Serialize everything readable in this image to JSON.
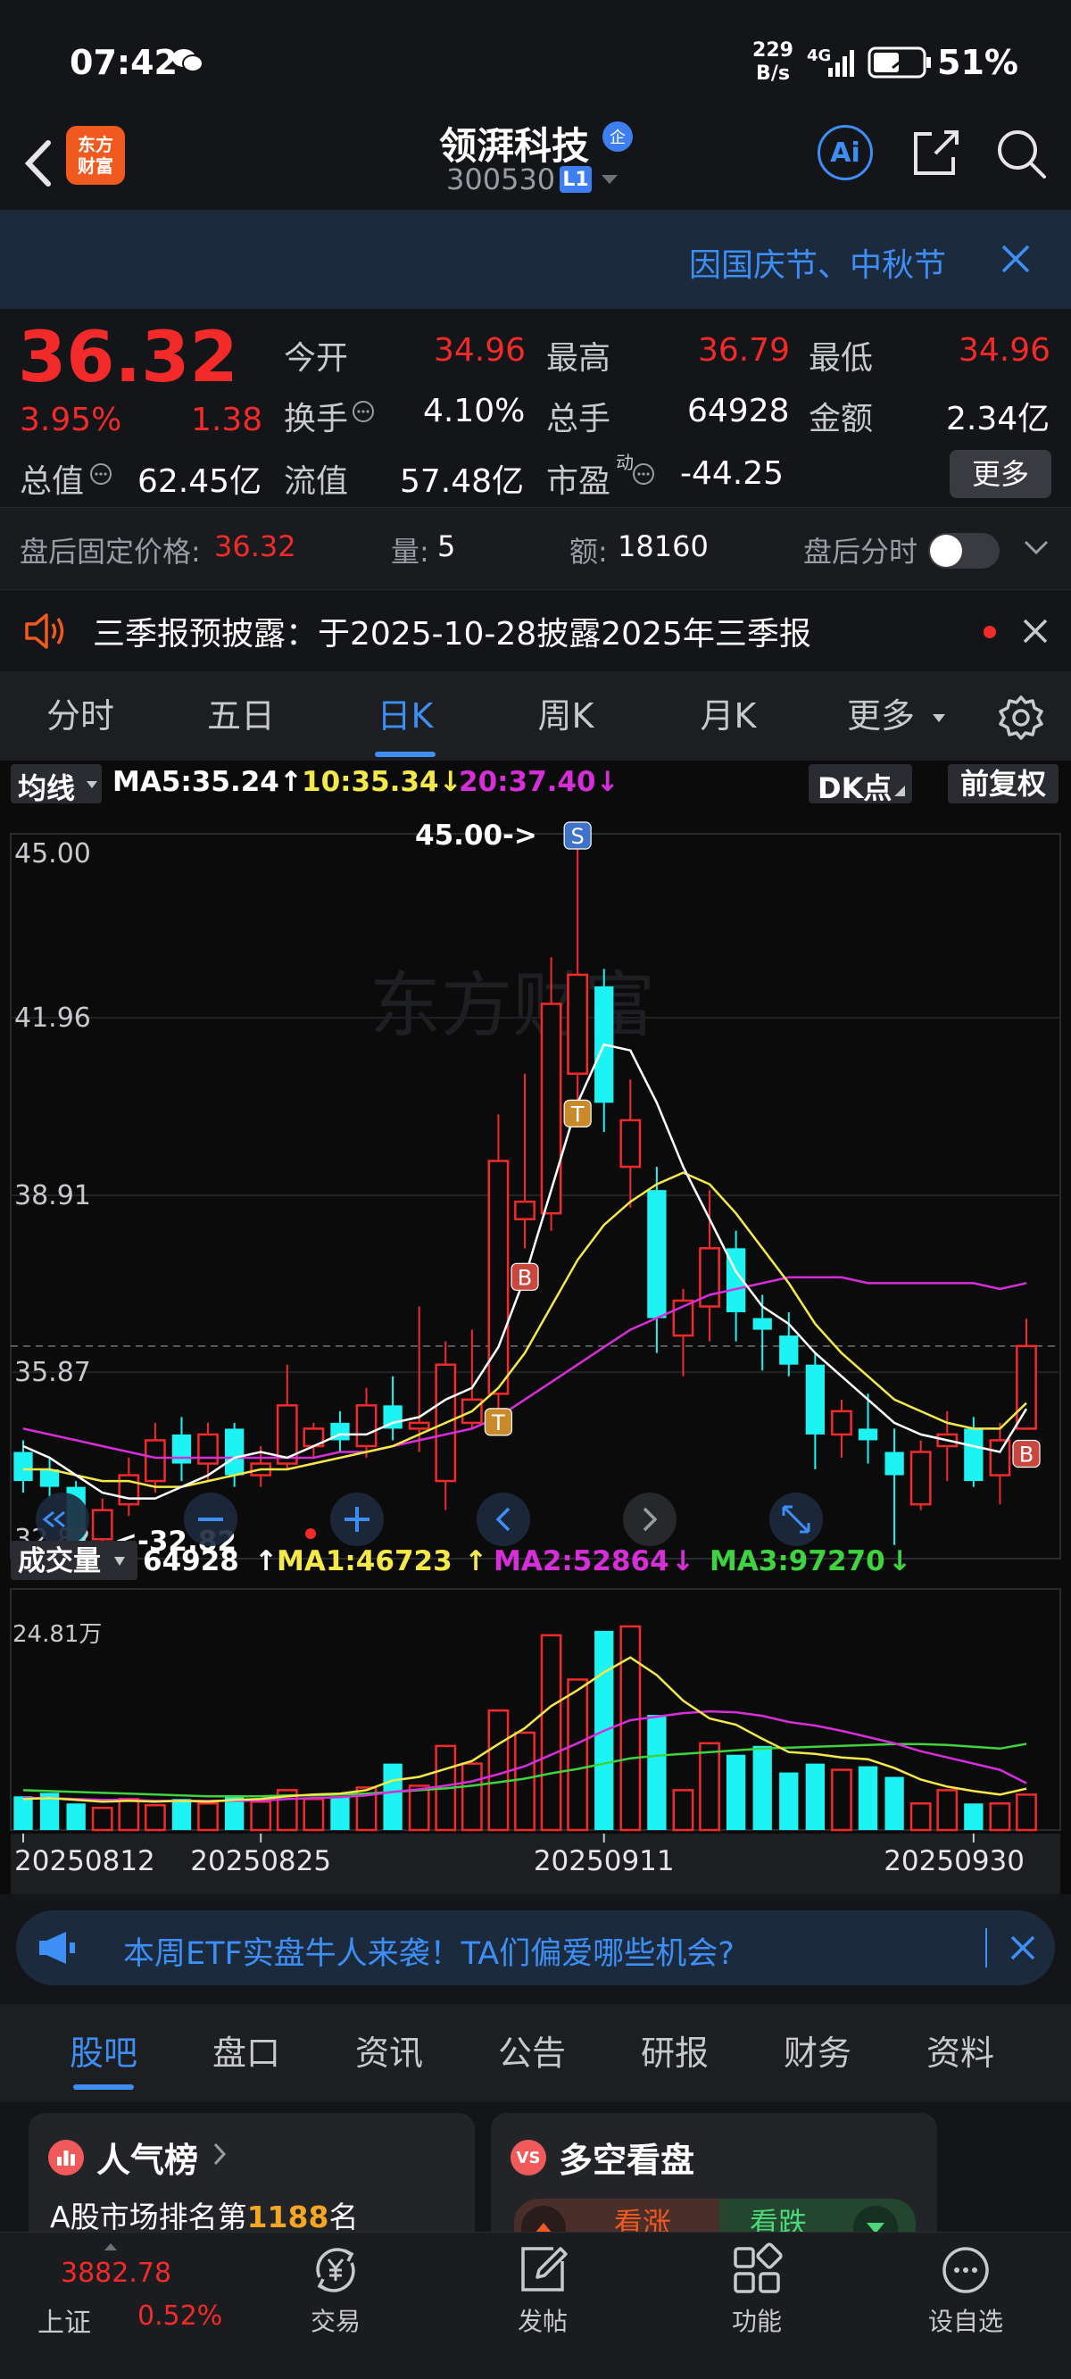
{
  "status": {
    "time": "07:42",
    "speed_top": "229",
    "speed_bottom": "B/s",
    "network": "4G",
    "battery": "51%"
  },
  "header": {
    "stock_name": "领湃科技",
    "code": "300530",
    "level": "L1",
    "logo_top": "东方",
    "logo_bottom": "财富",
    "ai_label": "Ai",
    "qi_badge": "企"
  },
  "banner": {
    "text": "因国庆节、中秋节"
  },
  "quote": {
    "price": "36.32",
    "pct": "3.95%",
    "change": "1.38",
    "rows": [
      [
        {
          "label": "今开",
          "value": "34.96",
          "color": "red"
        },
        {
          "label": "最高",
          "value": "36.79",
          "color": "red"
        },
        {
          "label": "最低",
          "value": "34.96",
          "color": "red"
        }
      ],
      [
        {
          "label": "换手",
          "value": "4.10%",
          "color": "white"
        },
        {
          "label": "总手",
          "value": "64928",
          "color": "white"
        },
        {
          "label": "金额",
          "value": "2.34亿",
          "color": "white"
        }
      ]
    ],
    "row3": [
      {
        "label": "总值",
        "value": "62.45亿"
      },
      {
        "label": "流值",
        "value": "57.48亿"
      },
      {
        "label": "市盈",
        "value": "-44.25",
        "sup": "动"
      }
    ],
    "more": "更多"
  },
  "after_hours": {
    "label": "盘后固定价格:",
    "price": "36.32",
    "vol_label": "量:",
    "vol": "5",
    "amt_label": "额:",
    "amt": "18160",
    "toggle_label": "盘后分时"
  },
  "notice": {
    "text": "三季报预披露：于2025-10-28披露2025年三季报"
  },
  "tabs": [
    "分时",
    "五日",
    "日K",
    "周K",
    "月K",
    "更多"
  ],
  "active_tab": 2,
  "kline": {
    "ma_selector": "均线",
    "ma5": "MA5:35.24",
    "ma10": "10:35.34",
    "ma20": "20:37.40",
    "dk_label": "DK点",
    "fq_label": "前复权",
    "high_marker": "45.00->",
    "low_marker": "<-32.82",
    "vol_selector": "成交量",
    "vol_value": "64928",
    "vma1": "MA1:46723",
    "vma2": "MA2:52864",
    "vma3": "MA3:97270",
    "vol_axis": "24.81万",
    "dates": [
      "20250812",
      "20250825",
      "20250911",
      "20250930"
    ],
    "watermark": "东方财富"
  },
  "chart_data": {
    "type": "candlestick",
    "ylim": [
      32.82,
      45.0
    ],
    "y_ticks": [
      "45.00",
      "41.96",
      "38.91",
      "35.87",
      "32.82"
    ],
    "candles": [
      {
        "o": 34.5,
        "c": 34.0,
        "h": 34.7,
        "l": 33.8
      },
      {
        "o": 34.2,
        "c": 33.9,
        "h": 34.4,
        "l": 33.7
      },
      {
        "o": 33.9,
        "c": 32.9,
        "h": 34.0,
        "l": 32.82
      },
      {
        "o": 33.0,
        "c": 33.5,
        "h": 33.7,
        "l": 32.9
      },
      {
        "o": 33.6,
        "c": 34.1,
        "h": 34.4,
        "l": 33.4
      },
      {
        "o": 34.0,
        "c": 34.7,
        "h": 35.0,
        "l": 33.8
      },
      {
        "o": 34.8,
        "c": 34.3,
        "h": 35.1,
        "l": 34.0
      },
      {
        "o": 34.3,
        "c": 34.8,
        "h": 35.0,
        "l": 34.0
      },
      {
        "o": 34.9,
        "c": 34.1,
        "h": 35.0,
        "l": 33.9
      },
      {
        "o": 34.1,
        "c": 34.3,
        "h": 34.6,
        "l": 33.9
      },
      {
        "o": 34.3,
        "c": 35.3,
        "h": 36.0,
        "l": 34.2
      },
      {
        "o": 34.6,
        "c": 34.9,
        "h": 35.0,
        "l": 34.4
      },
      {
        "o": 35.0,
        "c": 34.7,
        "h": 35.2,
        "l": 34.5
      },
      {
        "o": 34.6,
        "c": 35.3,
        "h": 35.6,
        "l": 34.4
      },
      {
        "o": 35.3,
        "c": 34.9,
        "h": 35.8,
        "l": 34.7
      },
      {
        "o": 34.9,
        "c": 35.0,
        "h": 37.0,
        "l": 34.5
      },
      {
        "o": 34.0,
        "c": 36.0,
        "h": 36.4,
        "l": 33.5
      },
      {
        "o": 35.0,
        "c": 35.4,
        "h": 36.6,
        "l": 34.9
      },
      {
        "o": 35.5,
        "c": 39.5,
        "h": 40.3,
        "l": 35.2
      },
      {
        "o": 38.5,
        "c": 38.8,
        "h": 41.0,
        "l": 38.0
      },
      {
        "o": 38.6,
        "c": 42.2,
        "h": 43.0,
        "l": 38.3
      },
      {
        "o": 41.0,
        "c": 42.7,
        "h": 45.0,
        "l": 40.5
      },
      {
        "o": 42.5,
        "c": 40.5,
        "h": 42.8,
        "l": 40.0
      },
      {
        "o": 39.4,
        "c": 40.2,
        "h": 40.9,
        "l": 38.7
      },
      {
        "o": 39.0,
        "c": 36.8,
        "h": 39.4,
        "l": 36.2
      },
      {
        "o": 36.5,
        "c": 37.1,
        "h": 37.3,
        "l": 35.8
      },
      {
        "o": 37.0,
        "c": 38.0,
        "h": 39.0,
        "l": 36.4
      },
      {
        "o": 38.0,
        "c": 36.9,
        "h": 38.3,
        "l": 36.4
      },
      {
        "o": 36.8,
        "c": 36.6,
        "h": 37.2,
        "l": 35.9
      },
      {
        "o": 36.5,
        "c": 36.0,
        "h": 36.9,
        "l": 35.8
      },
      {
        "o": 36.0,
        "c": 34.8,
        "h": 36.2,
        "l": 34.2
      },
      {
        "o": 34.8,
        "c": 35.2,
        "h": 35.4,
        "l": 34.4
      },
      {
        "o": 34.9,
        "c": 34.7,
        "h": 35.5,
        "l": 34.3
      },
      {
        "o": 34.5,
        "c": 34.1,
        "h": 34.9,
        "l": 32.9
      },
      {
        "o": 33.6,
        "c": 34.5,
        "h": 34.7,
        "l": 33.5
      },
      {
        "o": 34.6,
        "c": 34.8,
        "h": 35.2,
        "l": 34.0
      },
      {
        "o": 34.9,
        "c": 34.0,
        "h": 35.1,
        "l": 33.9
      },
      {
        "o": 34.1,
        "c": 34.7,
        "h": 35.0,
        "l": 33.6
      },
      {
        "o": 34.9,
        "c": 36.32,
        "h": 36.79,
        "l": 34.96
      }
    ],
    "ma5": [
      34.6,
      34.4,
      34.1,
      33.8,
      33.7,
      33.7,
      33.9,
      34.1,
      34.4,
      34.5,
      34.4,
      34.6,
      34.8,
      34.8,
      35.0,
      35.1,
      35.4,
      35.6,
      36.3,
      37.5,
      39.0,
      40.5,
      41.5,
      41.4,
      40.5,
      39.4,
      38.5,
      37.6,
      37.0,
      36.7,
      36.2,
      35.8,
      35.4,
      35.0,
      34.8,
      34.7,
      34.6,
      34.5,
      35.24
    ],
    "ma10": [
      34.2,
      34.2,
      34.1,
      34.0,
      34.0,
      33.9,
      33.9,
      34.0,
      34.1,
      34.2,
      34.2,
      34.3,
      34.4,
      34.5,
      34.6,
      34.8,
      35.0,
      35.2,
      35.6,
      36.2,
      37.0,
      37.8,
      38.4,
      38.8,
      39.1,
      39.3,
      39.1,
      38.6,
      38.0,
      37.4,
      36.7,
      36.2,
      35.8,
      35.4,
      35.2,
      35.0,
      34.9,
      34.9,
      35.34
    ],
    "ma20": [
      34.9,
      34.8,
      34.7,
      34.6,
      34.5,
      34.4,
      34.4,
      34.4,
      34.4,
      34.4,
      34.4,
      34.4,
      34.5,
      34.5,
      34.6,
      34.7,
      34.8,
      34.9,
      35.1,
      35.4,
      35.7,
      36.0,
      36.3,
      36.6,
      36.8,
      37.0,
      37.2,
      37.3,
      37.4,
      37.5,
      37.5,
      37.5,
      37.4,
      37.4,
      37.4,
      37.4,
      37.4,
      37.3,
      37.4
    ],
    "volume": [
      3.8,
      4.2,
      3.0,
      2.5,
      3.5,
      2.8,
      3.5,
      3.0,
      3.8,
      3.2,
      4.5,
      3.5,
      3.8,
      4.8,
      7.5,
      5.0,
      9.5,
      7.5,
      13.5,
      11.0,
      22.0,
      17.0,
      22.5,
      23.0,
      13.0,
      4.5,
      9.8,
      8.5,
      9.5,
      6.5,
      7.5,
      6.8,
      7.2,
      6.0,
      3.0,
      4.5,
      3.0,
      3.0,
      4.0
    ],
    "vol_ylim": [
      0,
      24.81
    ],
    "vma1": [
      3.5,
      3.6,
      3.4,
      3.2,
      3.3,
      3.2,
      3.3,
      3.2,
      3.4,
      3.5,
      3.8,
      4.0,
      4.1,
      4.5,
      5.6,
      6.0,
      6.9,
      7.8,
      9.7,
      11.5,
      14.0,
      15.8,
      17.8,
      19.5,
      17.5,
      14.6,
      12.6,
      11.9,
      10.3,
      8.8,
      8.6,
      8.2,
      8.0,
      7.0,
      5.7,
      4.9,
      4.4,
      4.0,
      4.67
    ],
    "vma2": [
      3.6,
      3.6,
      3.5,
      3.4,
      3.4,
      3.3,
      3.3,
      3.3,
      3.3,
      3.3,
      3.5,
      3.6,
      3.7,
      3.9,
      4.3,
      4.6,
      5.0,
      5.5,
      6.3,
      7.2,
      8.5,
      9.8,
      11.2,
      12.4,
      12.8,
      13.2,
      13.4,
      13.3,
      12.9,
      12.2,
      11.8,
      11.2,
      10.5,
      9.8,
      8.9,
      8.2,
      7.5,
      6.8,
      5.29
    ],
    "vma3": [
      4.5,
      4.4,
      4.3,
      4.2,
      4.1,
      4.0,
      3.9,
      3.8,
      3.8,
      3.8,
      3.9,
      3.9,
      4.0,
      4.1,
      4.3,
      4.5,
      4.7,
      5.0,
      5.4,
      5.8,
      6.4,
      6.9,
      7.5,
      8.1,
      8.4,
      8.6,
      8.8,
      9.0,
      9.2,
      9.3,
      9.4,
      9.5,
      9.6,
      9.7,
      9.7,
      9.6,
      9.4,
      9.2,
      9.73
    ],
    "signals": [
      {
        "i": 21,
        "label": "S",
        "pos": "above"
      },
      {
        "i": 18,
        "label": "T",
        "pos": "below"
      },
      {
        "i": 21,
        "label": "T",
        "pos": "below"
      },
      {
        "i": 19,
        "label": "B",
        "pos": "below"
      },
      {
        "i": 38,
        "label": "B",
        "pos": "below"
      }
    ],
    "x_labels": [
      "20250812",
      "20250825",
      "20250911",
      "20250930"
    ]
  },
  "ad": {
    "text": "本周ETF实盘牛人来袭！TA们偏爱哪些机会?"
  },
  "subtabs": [
    "股吧",
    "盘口",
    "资讯",
    "公告",
    "研报",
    "财务",
    "资料"
  ],
  "cards": {
    "popularity_title": "人气榜",
    "popularity_text_prefix": "A股市场排名第",
    "popularity_rank": "1188",
    "popularity_text_suffix": "名",
    "vs_title": "多空看盘",
    "bull": "看涨",
    "bear": "看跌"
  },
  "bottom": {
    "index_value": "3882.78",
    "index_name": "上证",
    "index_pct": "0.52%",
    "items": [
      "交易",
      "发帖",
      "功能",
      "设自选"
    ]
  },
  "colors": {
    "up": "#f32a2a",
    "down": "#1ef3f3",
    "accent": "#3d8ff5",
    "ma5": "#ffffff",
    "ma10": "#f5e94a",
    "ma20": "#d62ed8",
    "vma3": "#3fd33f"
  }
}
